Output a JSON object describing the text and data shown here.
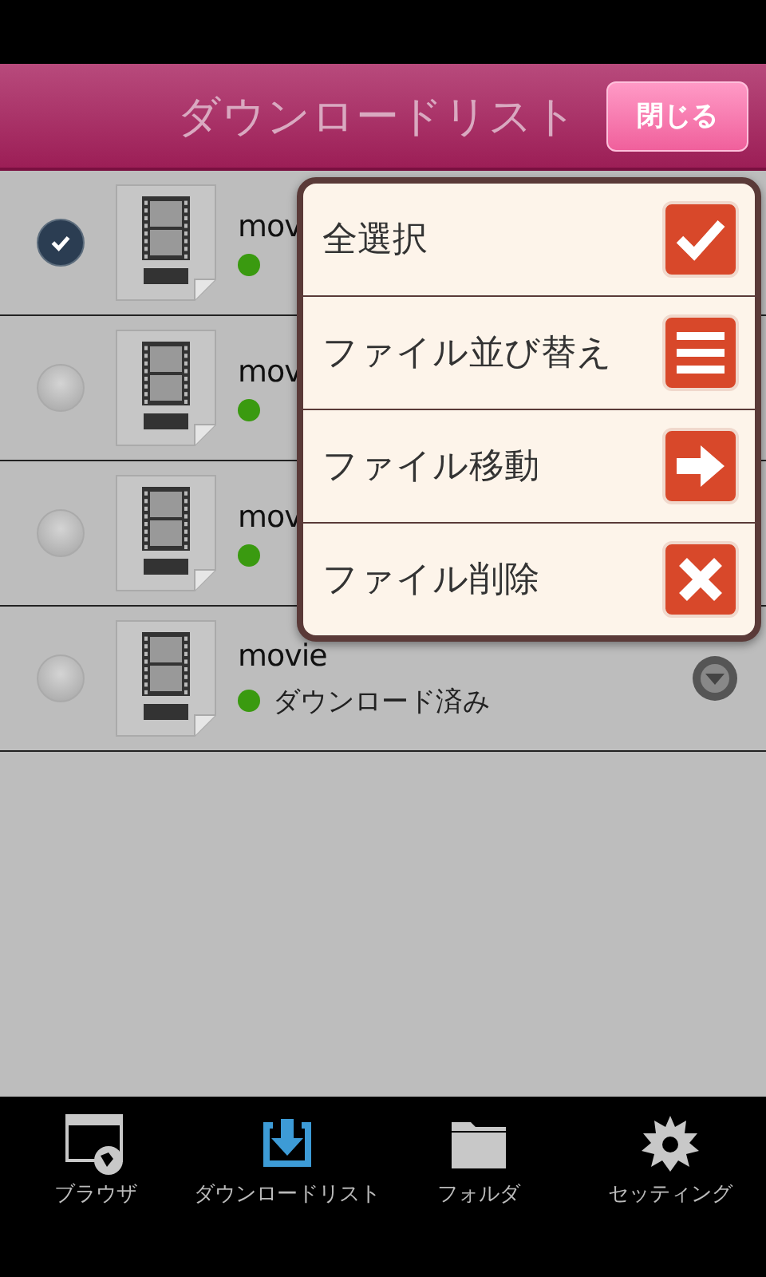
{
  "header": {
    "title": "ダウンロードリスト",
    "close_button": "閉じる"
  },
  "files": [
    {
      "name": "mov",
      "checked": true
    },
    {
      "name": "mov",
      "checked": false
    },
    {
      "name": "mov",
      "checked": false
    },
    {
      "name": "movie",
      "status": "ダウンロード済み",
      "checked": false,
      "menu_button": true
    }
  ],
  "menu": [
    {
      "label": "全選択",
      "kind": "check"
    },
    {
      "label": "ファイル並び替え",
      "kind": "sort"
    },
    {
      "label": "ファイル移動",
      "kind": "move"
    },
    {
      "label": "ファイル削除",
      "kind": "delete"
    }
  ],
  "tabs": [
    {
      "label": "ブラウザ",
      "kind": "browser",
      "selected": false
    },
    {
      "label": "ダウンロードリスト",
      "kind": "download",
      "selected": true
    },
    {
      "label": "フォルダ",
      "kind": "folder",
      "selected": false
    },
    {
      "label": "セッティング",
      "kind": "settings",
      "selected": false
    }
  ]
}
